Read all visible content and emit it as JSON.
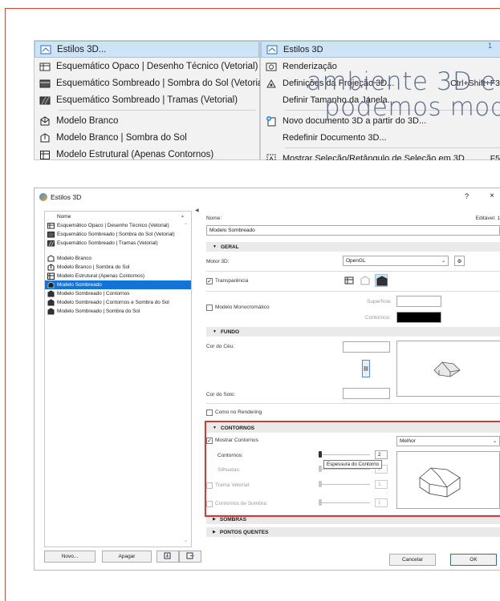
{
  "menu_left": {
    "items": [
      {
        "label": "Estilos 3D...",
        "icon": "style-3d-icon",
        "highlighted": true
      },
      {
        "label": "Esquemático Opaco | Desenho Técnico (Vetorial)",
        "icon": "opaque-schematic-icon"
      },
      {
        "label": "Esquemático Sombreado  | Sombra do Sol (Vetorial)",
        "icon": "shaded-schematic-icon"
      },
      {
        "label": "Esquemático Sombreado | Tramas (Vetorial)",
        "icon": "shaded-hatch-icon"
      },
      {
        "label": "Modelo Branco",
        "icon": "white-model-icon"
      },
      {
        "label": "Modelo Branco | Sombra do Sol",
        "icon": "white-model-sun-icon"
      },
      {
        "label": "Modelo Estrutural (Apenas Contornos)",
        "icon": "structural-model-icon"
      }
    ]
  },
  "menu_right": {
    "items": [
      {
        "label": "Estilos 3D",
        "icon": "style-3d-icon",
        "highlighted": true,
        "submenu": true
      },
      {
        "label": "Renderização",
        "icon": "camera-icon"
      },
      {
        "label": "Definições da Projeção 3D...",
        "icon": "projection-icon",
        "shortcut": "Ctrl+Shift+F3"
      },
      {
        "label": "Definir Tamanho da Janela...",
        "icon": ""
      },
      {
        "label": "Novo documento 3D a partir do 3D...",
        "icon": "new-3d-doc-icon"
      },
      {
        "label": "Redefinir Documento 3D...",
        "icon": ""
      },
      {
        "label": "Mostrar Seleção/Retângulo de Seleção em 3D",
        "icon": "selection-3d-icon",
        "shortcut": "F5"
      }
    ],
    "corner_number": "1"
  },
  "overlay": {
    "line1": "ambiente 3D e s",
    "line2": "podemos  mod"
  },
  "dialog": {
    "title": "Estilos 3D",
    "help": "?",
    "close": "×",
    "list_header": "Nome",
    "list_items": [
      {
        "label": "Esquemático Opaco | Desenho Técnico (Vetorial)",
        "icon": "opaque-schematic-icon"
      },
      {
        "label": "Esquemático Sombreado  | Sombra do Sol (Vetorial)",
        "icon": "shaded-schematic-icon"
      },
      {
        "label": "Esquemático Sombreado | Tramas (Vetorial)",
        "icon": "shaded-hatch-icon"
      },
      {
        "label": "Modelo Branco",
        "icon": "white-model-icon"
      },
      {
        "label": "Modelo Branco | Sombra do Sol",
        "icon": "white-model-sun-icon"
      },
      {
        "label": "Modelo Estrutural (Apenas Contornos)",
        "icon": "structural-model-icon"
      },
      {
        "label": "Modelo Sombreado",
        "icon": "shaded-model-icon",
        "selected": true
      },
      {
        "label": "Modelo Sombreado | Contornos",
        "icon": "shaded-model-icon"
      },
      {
        "label": "Modelo Sombreado | Contornos e Sombra do Sol",
        "icon": "shaded-model-icon"
      },
      {
        "label": "Modelo Sombreado | Sombra do Sol",
        "icon": "shaded-model-icon"
      }
    ],
    "buttons": {
      "new": "Novo...",
      "delete": "Apagar",
      "cancel": "Cancelar",
      "ok": "OK"
    },
    "name_label": "Nome:",
    "editable_label": "Editável: 1",
    "name_value": "Modelo Sombreado",
    "sections": {
      "geral": "GERAL",
      "fundo": "FUNDO",
      "contornos": "CONTORNOS",
      "sombras": "SOMBRAS",
      "pontos_quentes": "PONTOS QUENTES"
    },
    "geral": {
      "engine_label": "Motor 3D:",
      "engine_value": "OpenGL",
      "transparency_label": "Transparência",
      "transparency_checked": true,
      "mono_label": "Modelo Monocromático",
      "mono_checked": false,
      "surface_label": "Superfície:",
      "contours_label": "Contornos:",
      "surface_color": "#ffffff",
      "contours_color": "#000000"
    },
    "fundo": {
      "sky_label": "Cor do Céu:",
      "ground_label": "Cor do Solo:",
      "rendering_label": "Como no Rendering",
      "rendering_checked": false
    },
    "contornos": {
      "show_label": "Mostrar Contornos",
      "show_checked": true,
      "quality_value": "Melhor",
      "contours_label": "Contornos:",
      "contours_value": "2",
      "contours_level": 0.0,
      "silhouettes_label": "Silhuetas:",
      "silhouettes_value": "2",
      "tooltip": "Espessura do Contorno",
      "vector_hatch_label": "Trama Vetorial:",
      "vector_hatch_value": "1",
      "shadow_contours_label": "Contornos de Sombra:",
      "shadow_contours_value": "1"
    }
  },
  "colors": {
    "accent": "#1473d8",
    "highlight_red": "#d93636",
    "frame_orange": "#e0492c"
  }
}
